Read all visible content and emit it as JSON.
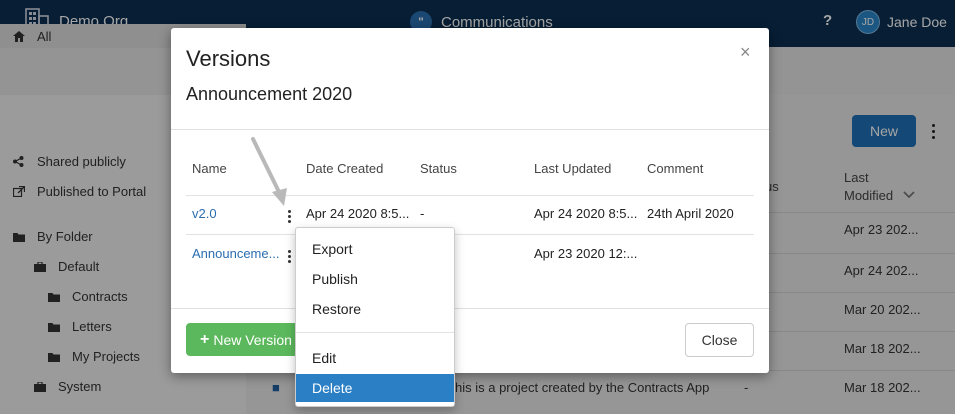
{
  "topbar": {
    "org_name": "Demo Org",
    "app_name": "Communications",
    "help_label": "?",
    "user_initials": "JD",
    "user_name": "Jane Doe"
  },
  "sidebar": {
    "items": [
      {
        "label": "All",
        "icon": "home-icon"
      },
      {
        "label": "Shared publicly",
        "icon": "share-icon"
      },
      {
        "label": "Published to Portal",
        "icon": "external-link-icon"
      },
      {
        "label": "By Folder",
        "icon": "folder-icon"
      },
      {
        "label": "Default",
        "icon": "briefcase-icon"
      },
      {
        "label": "Contracts",
        "icon": "folder-icon"
      },
      {
        "label": "Letters",
        "icon": "folder-icon"
      },
      {
        "label": "My Projects",
        "icon": "folder-icon"
      },
      {
        "label": "System",
        "icon": "briefcase-icon"
      }
    ]
  },
  "main": {
    "new_label": "New",
    "columns": {
      "status_partial": "us",
      "last_modified_line1": "Last",
      "last_modified_line2": "Modified"
    },
    "rows": [
      {
        "modified": "Apr 23 202..."
      },
      {
        "modified": "Apr 24 202..."
      },
      {
        "modified": "Mar 20 202..."
      },
      {
        "modified": "Mar 18 202..."
      },
      {
        "desc": "his is a project created by the Contracts App",
        "status": "-",
        "modified": "Mar 18 202..."
      }
    ]
  },
  "modal": {
    "title": "Versions",
    "close_glyph": "×",
    "subtitle": "Announcement 2020",
    "headers": {
      "name": "Name",
      "date_created": "Date Created",
      "status": "Status",
      "last_updated": "Last Updated",
      "comment": "Comment"
    },
    "rows": [
      {
        "name": "v2.0",
        "date_created": "Apr 24 2020 8:5...",
        "status": "-",
        "last_updated": "Apr 24 2020 8:5...",
        "comment": "24th April 2020"
      },
      {
        "name": "Announceme...",
        "date_created": "",
        "status": "",
        "last_updated": "Apr 23 2020 12:...",
        "comment": ""
      }
    ],
    "new_version_label": "New Version",
    "close_label": "Close"
  },
  "menu": {
    "items": [
      "Export",
      "Publish",
      "Restore"
    ],
    "items2": [
      "Edit",
      "Delete"
    ],
    "active": "Delete"
  },
  "colors": {
    "topbar": "#0b2f52",
    "primary": "#1f6fb5",
    "success": "#5cb85c",
    "link": "#2a6db0",
    "menu_active": "#2a7fc5"
  }
}
